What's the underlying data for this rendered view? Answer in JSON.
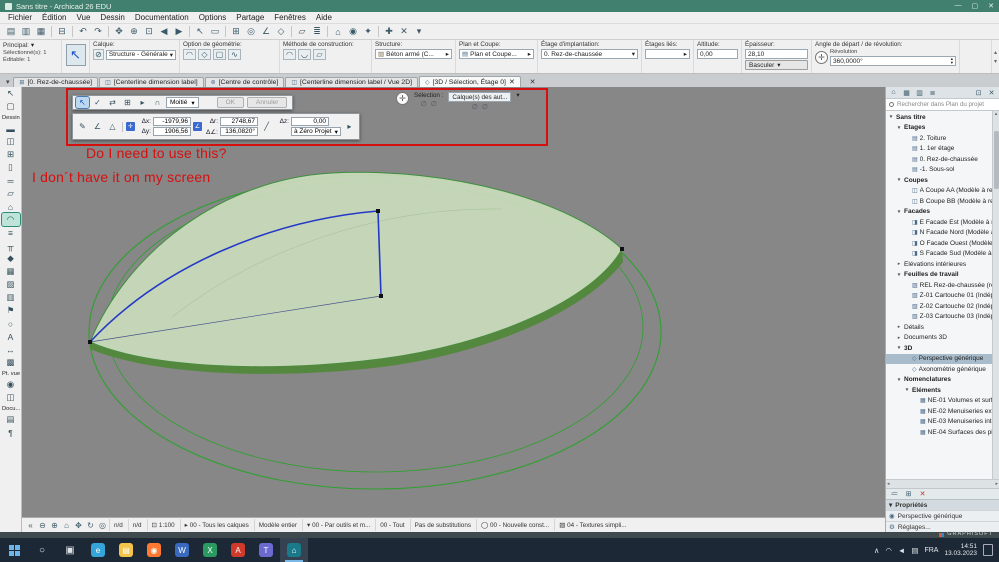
{
  "colors": {
    "titlebar": "#41806e",
    "canvas_bg": "#878787",
    "dome_fill": "#c8dcba",
    "dome_edge": "#55883f",
    "dome_stroke": "#3f8f3f",
    "outline_green": "#2fa02f",
    "selection_blue": "#2438c8",
    "annotation_red": "#d60f0f",
    "taskbar_bg": "#1c2836"
  },
  "window": {
    "title": "Sans titre - Archicad 26 EDU",
    "minimize": "—",
    "maximize": "▢",
    "close": "✕"
  },
  "glyphs": {
    "dropdown": "▾",
    "spin_up": "▴",
    "spin_down": "▾",
    "left": "◂",
    "right": "▸",
    "close": "✕",
    "check": "✓",
    "slash": "╱",
    "empty_set": "∅",
    "compass": "✛",
    "collapse": "«",
    "chevron_up": "∧"
  },
  "menubar": {
    "items": [
      "Fichier",
      "Édition",
      "Vue",
      "Dessin",
      "Documentation",
      "Options",
      "Partage",
      "Fenêtres",
      "Aide"
    ]
  },
  "top_toolbar": {
    "icons": [
      {
        "name": "layouts-icon",
        "glyph": "▤"
      },
      {
        "name": "open-icon",
        "glyph": "▥"
      },
      {
        "name": "save-icon",
        "glyph": "▦"
      },
      {
        "sep": true
      },
      {
        "name": "print-icon",
        "glyph": "⊟"
      },
      {
        "sep": true
      },
      {
        "name": "undo-icon",
        "glyph": "↶"
      },
      {
        "name": "redo-icon",
        "glyph": "↷"
      },
      {
        "sep": true
      },
      {
        "name": "pan-icon",
        "glyph": "✥"
      },
      {
        "name": "zoom-icon",
        "glyph": "⊕"
      },
      {
        "name": "fit-in-window-icon",
        "glyph": "⊡"
      },
      {
        "name": "previous-view-icon",
        "glyph": "◀"
      },
      {
        "name": "next-view-icon",
        "glyph": "▶"
      },
      {
        "sep": true
      },
      {
        "name": "select-arrow-icon",
        "glyph": "↖"
      },
      {
        "name": "marquee-icon",
        "glyph": "▭"
      },
      {
        "sep": true
      },
      {
        "name": "grid-snap-icon",
        "glyph": "⊞"
      },
      {
        "name": "gravity-icon",
        "glyph": "◎"
      },
      {
        "name": "guide-lines-icon",
        "glyph": "∠"
      },
      {
        "name": "snap-points-icon",
        "glyph": "◇"
      },
      {
        "sep": true
      },
      {
        "name": "suspend-groups-icon",
        "glyph": "▱"
      },
      {
        "name": "layers-icon",
        "glyph": "≣"
      },
      {
        "sep": true
      },
      {
        "name": "3d-view-icon",
        "glyph": "⌂"
      },
      {
        "name": "camera-icon",
        "glyph": "◉"
      },
      {
        "name": "sun-study-icon",
        "glyph": "✦"
      },
      {
        "sep": true
      },
      {
        "name": "add-icon",
        "glyph": "✚"
      },
      {
        "name": "delete-icon",
        "glyph": "✕"
      },
      {
        "name": "toolbar-more-icon",
        "glyph": "▾"
      }
    ]
  },
  "infobox": {
    "principal_label": "Principal:",
    "selected_info": "Sélectionné(s): 1",
    "editable_info": "Éditable: 1",
    "calque_label": "Calque:",
    "calque_value": "Structure - Générale",
    "geometry_label": "Option de géométrie:",
    "geometry_icons": [
      {
        "name": "revolved-shell-icon",
        "glyph": "◠"
      },
      {
        "name": "extruded-shell-icon",
        "glyph": "◇"
      },
      {
        "name": "ruled-shell-icon",
        "glyph": "▢"
      },
      {
        "name": "freeform-shell-icon",
        "glyph": "∿"
      }
    ],
    "construction_label": "Méthode de construction:",
    "construction_icons": [
      {
        "name": "simple-method-icon",
        "glyph": "◠"
      },
      {
        "name": "complex-method-icon",
        "glyph": "◡"
      },
      {
        "name": "distorted-method-icon",
        "glyph": "▱"
      }
    ],
    "structure_label": "Structure:",
    "structure_value": "Béton armé (C...",
    "plan_label": "Plan et Coupe:",
    "plan_value": "Plan et Coupe...",
    "etage_label": "Étage d'implantation:",
    "etage_value": "0. Rez-de-chaussée",
    "lies_label": "Étages liés:",
    "altitude_label": "Altitude:",
    "altitude_value": "0,00",
    "epaisseur_label": "Épaisseur:",
    "epaisseur_value": "28,10",
    "basculer_label": "Basculer",
    "angle_label": "Angle de départ / de révolution:",
    "revolution_label": "Révolution",
    "revolution_value": "360,0000°"
  },
  "tabbar": {
    "tabs": [
      {
        "icon": "⊞",
        "label": "[0. Rez-de-chaussée]"
      },
      {
        "icon": "◫",
        "label": "[Centerline dimension label]"
      },
      {
        "icon": "⊚",
        "label": "[Centre de contrôle]"
      },
      {
        "icon": "◫",
        "label": "[Centerline dimension label / Vue 2D]"
      },
      {
        "icon": "◇",
        "label": "[3D / Sélection, Étage 0]",
        "active": true,
        "close_glyph": "✕"
      }
    ]
  },
  "toolbox": {
    "header": "Dessin",
    "pt_vue_header": "Pt. vue",
    "docu_header": "Docu...",
    "top_icons": [
      {
        "name": "arrow-tool-icon",
        "glyph": "↖"
      },
      {
        "name": "marquee-tool-icon",
        "glyph": "▢"
      }
    ],
    "icons": [
      {
        "name": "wall-tool-icon",
        "glyph": "▬"
      },
      {
        "name": "door-tool-icon",
        "glyph": "◫"
      },
      {
        "name": "window-tool-icon",
        "glyph": "⊞"
      },
      {
        "name": "column-tool-icon",
        "glyph": "▯"
      },
      {
        "name": "beam-tool-icon",
        "glyph": "═"
      },
      {
        "name": "slab-tool-icon",
        "glyph": "▱"
      },
      {
        "name": "roof-tool-icon",
        "glyph": "⌂"
      },
      {
        "name": "shell-tool-icon",
        "glyph": "◠",
        "selected": true
      },
      {
        "name": "stair-tool-icon",
        "glyph": "≡"
      },
      {
        "name": "railing-tool-icon",
        "glyph": "╥"
      },
      {
        "name": "morph-tool-icon",
        "glyph": "◆"
      },
      {
        "name": "mesh-tool-icon",
        "glyph": "▦"
      },
      {
        "name": "zone-tool-icon",
        "glyph": "▨"
      },
      {
        "name": "curtain-wall-tool-icon",
        "glyph": "▥"
      },
      {
        "name": "object-tool-icon",
        "glyph": "⚑"
      },
      {
        "name": "lamp-tool-icon",
        "glyph": "○"
      },
      {
        "name": "text-tool-icon",
        "glyph": "A"
      },
      {
        "name": "dimension-tool-icon",
        "glyph": "↔"
      },
      {
        "name": "fill-tool-icon",
        "glyph": "▩"
      }
    ],
    "pt_vue_icons": [
      {
        "name": "camera-viewpoint-icon",
        "glyph": "◉"
      },
      {
        "name": "section-viewpoint-icon",
        "glyph": "◫"
      }
    ],
    "docu_icons": [
      {
        "name": "drawing-doc-icon",
        "glyph": "▤"
      },
      {
        "name": "text-doc-icon",
        "glyph": "¶"
      }
    ]
  },
  "palette": {
    "row1_icons": [
      {
        "name": "arrow-mode-icon",
        "glyph": "↖",
        "active": true
      },
      {
        "name": "confirm-icon",
        "glyph": "✓"
      },
      {
        "name": "move-node-icon",
        "glyph": "⇄"
      },
      {
        "name": "offset-edge-icon",
        "glyph": "⊞"
      },
      {
        "name": "next-option-icon",
        "glyph": "▸"
      },
      {
        "name": "magnet-icon",
        "glyph": "∩"
      }
    ],
    "moitie_label": "Moitié",
    "ok_label": "OK",
    "annuler_label": "Annuler",
    "row2_icons": [
      {
        "name": "pencil-icon",
        "glyph": "✎"
      },
      {
        "name": "angle-icon",
        "glyph": "∠"
      },
      {
        "name": "triangle-icon",
        "glyph": "△"
      }
    ],
    "coords": {
      "dx_label": "Δx:",
      "dx_value": "-1979,96",
      "dy_label": "Δy:",
      "dy_value": "1906,56",
      "dr_label": "Δr:",
      "dr_value": "2748,67",
      "da_label": "Δ∠:",
      "da_value": "136,0820°",
      "dz_label": "Δz:",
      "dz_value": "0,00",
      "zero_value": "à Zéro Projet"
    },
    "selection_label": "Sélection :",
    "calques_label": "Calque(s) des aut..."
  },
  "annotation": {
    "line1": "Do I need to use this?",
    "line2": "I don´t have it on my screen"
  },
  "navigator": {
    "toolbar_left": [
      {
        "name": "project-map-icon",
        "glyph": "⌂"
      },
      {
        "name": "view-map-icon",
        "glyph": "▦"
      },
      {
        "name": "layout-book-icon",
        "glyph": "▥"
      },
      {
        "name": "publisher-icon",
        "glyph": "≣"
      }
    ],
    "toolbar_right": [
      {
        "name": "pin-palette-icon",
        "glyph": "⊡"
      },
      {
        "name": "close-panel-icon",
        "glyph": "✕"
      }
    ],
    "search_placeholder": "Rechercher dans Plan du projet",
    "tree": [
      {
        "chev": "▾",
        "label": "Sans titre",
        "level": 0,
        "bold": true,
        "name": "tree-item-sans-titre"
      },
      {
        "chev": "▾",
        "label": "Étages",
        "level": 1,
        "bold": true
      },
      {
        "icon": "▤",
        "label": "2. Toiture",
        "level": 2
      },
      {
        "icon": "▤",
        "label": "1. 1er étage",
        "level": 2
      },
      {
        "icon": "▤",
        "label": "0. Rez-de-chaussée",
        "level": 2
      },
      {
        "icon": "▤",
        "label": "-1. Sous-sol",
        "level": 2
      },
      {
        "chev": "▾",
        "label": "Coupes",
        "level": 1,
        "bold": true
      },
      {
        "icon": "◫",
        "label": "A Coupe AA (Modèle à rec",
        "level": 2
      },
      {
        "icon": "◫",
        "label": "B Coupe BB (Modèle à rec",
        "level": 2
      },
      {
        "chev": "▾",
        "label": "Facades",
        "level": 1,
        "bold": true
      },
      {
        "icon": "◨",
        "label": "E Facade Est (Modèle à re",
        "level": 2
      },
      {
        "icon": "◨",
        "label": "N Facade Nord (Modèle à",
        "level": 2
      },
      {
        "icon": "◨",
        "label": "O Facade Ouest (Modèle à",
        "level": 2
      },
      {
        "icon": "◨",
        "label": "S Facade Sud (Modèle à re",
        "level": 2
      },
      {
        "chev": "▸",
        "label": "Élévations intérieures",
        "level": 1
      },
      {
        "chev": "▾",
        "label": "Feuilles de travail",
        "level": 1,
        "bold": true
      },
      {
        "icon": "▧",
        "label": "REL Rez-de-chaussée (rele",
        "level": 2
      },
      {
        "icon": "▧",
        "label": "Z-01 Cartouche 01 (Indépe",
        "level": 2
      },
      {
        "icon": "▧",
        "label": "Z-02 Cartouche 02 (Indépe",
        "level": 2
      },
      {
        "icon": "▧",
        "label": "Z-03 Cartouche 03 (Indépe",
        "level": 2
      },
      {
        "chev": "▸",
        "label": "Détails",
        "level": 1
      },
      {
        "chev": "▸",
        "label": "Documents 3D",
        "level": 1
      },
      {
        "chev": "▾",
        "label": "3D",
        "level": 1,
        "bold": true
      },
      {
        "icon": "◇",
        "label": "Perspective générique",
        "level": 2,
        "selected": true,
        "name": "tree-item-perspective-generique"
      },
      {
        "icon": "◇",
        "label": "Axonométrie générique",
        "level": 2
      },
      {
        "chev": "▾",
        "label": "Nomenclatures",
        "level": 1,
        "bold": true
      },
      {
        "chev": "▾",
        "label": "Éléments",
        "level": 2,
        "bold": true
      },
      {
        "icon": "▦",
        "label": "NE-01 Volumes et surface",
        "level": 3
      },
      {
        "icon": "▦",
        "label": "NE-02 Menuiseries extéri",
        "level": 3
      },
      {
        "icon": "▦",
        "label": "NE-03 Menuiseries intérie",
        "level": 3
      },
      {
        "icon": "▦",
        "label": "NE-04 Surfaces des pièce",
        "level": 3
      }
    ],
    "bottom_icons": [
      {
        "name": "view-settings-icon",
        "glyph": "≔"
      },
      {
        "name": "clone-folder-icon",
        "glyph": "⊞"
      },
      {
        "name": "delete-view-icon",
        "glyph": "✕",
        "fg": "#c03030"
      }
    ],
    "props_header": "Propriétés",
    "current_view": "Perspective générique",
    "settings_label": "Réglages..."
  },
  "statusbar": {
    "icons": [
      {
        "name": "collapse-icon",
        "glyph": "«"
      },
      {
        "name": "zoom-out-icon",
        "glyph": "⊖"
      },
      {
        "name": "zoom-in-icon",
        "glyph": "⊕"
      },
      {
        "name": "home-zoom-icon",
        "glyph": "⌂"
      },
      {
        "name": "pan-icon",
        "glyph": "✥"
      },
      {
        "name": "orbit-icon",
        "glyph": "↻"
      },
      {
        "name": "explore-icon",
        "glyph": "◎"
      }
    ],
    "fields": [
      {
        "label": "n/d",
        "name": "position-field"
      },
      {
        "label": "n/d",
        "name": "angle-field"
      },
      {
        "icon": "⊡",
        "label": "1:100",
        "name": "scale-field"
      },
      {
        "icon": "▸",
        "label": "00 - Tous les calques",
        "name": "layer-combination-field"
      },
      {
        "label": "Modèle entier",
        "name": "structure-display-field"
      },
      {
        "icon": "▾",
        "label": "00 - Par outils et m...",
        "name": "pen-set-field"
      },
      {
        "label": "00 - Tout",
        "name": "model-view-options-field"
      },
      {
        "label": "Pas de substitutions",
        "name": "graphic-overrides-field"
      },
      {
        "icon": "◯",
        "label": "00 - Nouvelle const...",
        "name": "renovation-filter-field"
      },
      {
        "icon": "▨",
        "label": "04 - Textures simpli...",
        "name": "3d-style-field"
      }
    ]
  },
  "strip_brand": "GRAPHISOFT",
  "taskbar": {
    "apps": [
      {
        "name": "edge-icon",
        "glyph": "e",
        "color": "#35a4d8"
      },
      {
        "name": "file-explorer-icon",
        "glyph": "▤",
        "color": "#f4c34a"
      },
      {
        "name": "firefox-icon",
        "glyph": "◉",
        "color": "#ff7a30"
      },
      {
        "name": "word-icon",
        "glyph": "W",
        "color": "#3a6ac0"
      },
      {
        "name": "excel-icon",
        "glyph": "X",
        "color": "#2a9a60"
      },
      {
        "name": "acrobat-icon",
        "glyph": "A",
        "color": "#d03a2a"
      },
      {
        "name": "teams-icon",
        "glyph": "T",
        "color": "#6a6ad0"
      },
      {
        "name": "archicad-icon",
        "glyph": "⌂",
        "color": "#1a7a8a",
        "active": true
      }
    ],
    "tray_icons": [
      {
        "name": "tray-chevron-icon",
        "glyph": "∧"
      },
      {
        "name": "onedrive-icon",
        "glyph": "◠"
      },
      {
        "name": "volume-icon",
        "glyph": "◄"
      },
      {
        "name": "network-icon",
        "glyph": "▤"
      }
    ],
    "lang": "FRA",
    "time": "14:51",
    "date": "13.03.2023"
  }
}
